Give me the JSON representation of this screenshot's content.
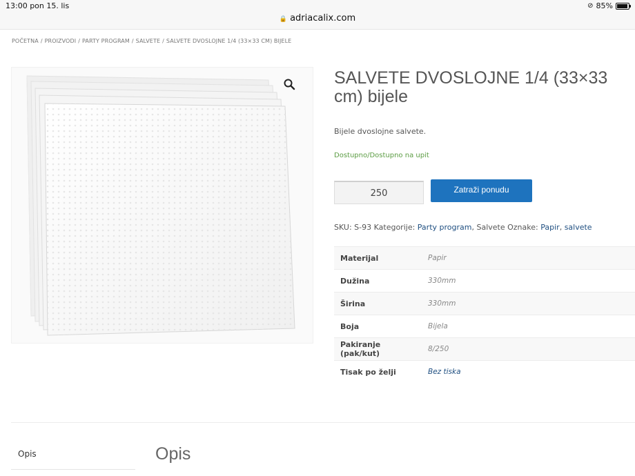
{
  "status_bar": {
    "time": "13:00  pon 15. lis",
    "battery": "85%",
    "url": "adriacalix.com",
    "battery_level": 0.85
  },
  "breadcrumb": [
    "POČETNA",
    "PROIZVODI",
    "PARTY PROGRAM",
    "SALVETE",
    "SALVETE DVOSLOJNE 1/4 (33×33 CM) BIJELE"
  ],
  "product": {
    "title": "SALVETE DVOSLOJNE 1/4 (33×33 cm) bijele",
    "description": "Bijele dvoslojne salvete.",
    "stock": "Dostupno/Dostupno na upit",
    "quantity": "250",
    "quote_button": "Zatraži ponudu",
    "meta": {
      "sku_label": "SKU:",
      "sku": "S-93",
      "categories_label": "Kategorije:",
      "category_link": "Party program",
      "category_plain": "Salvete",
      "tags_label": "Oznake:",
      "tag1": "Papir",
      "tag2": "salvete"
    },
    "specs": [
      {
        "key": "Materijal",
        "value": "Papir"
      },
      {
        "key": "Dužina",
        "value": "330mm"
      },
      {
        "key": "Širina",
        "value": "330mm"
      },
      {
        "key": "Boja",
        "value": "Bijela"
      },
      {
        "key": "Pakiranje (pak/kut)",
        "value": "8/250"
      },
      {
        "key": "Tisak po želji",
        "value": "Bez tiska"
      }
    ]
  },
  "tabs": {
    "description_tab": "Opis",
    "description_heading": "Opis"
  },
  "colors": {
    "accent": "#1e73be",
    "stock": "#5b9c43",
    "link": "#1e4e80"
  }
}
